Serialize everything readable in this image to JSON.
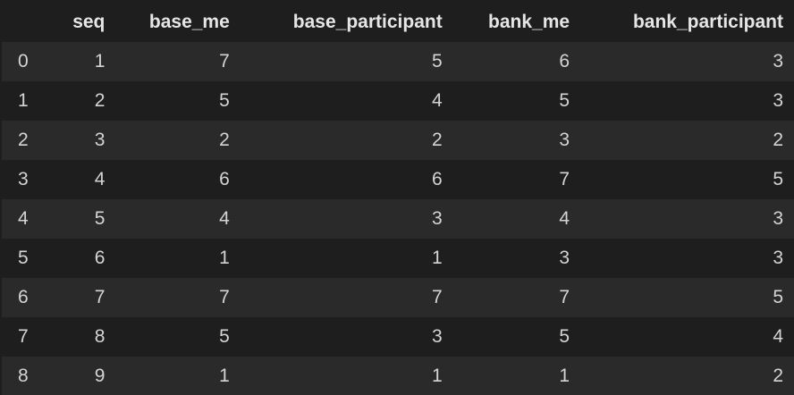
{
  "table": {
    "index_header": "",
    "columns": [
      "seq",
      "base_me",
      "base_participant",
      "bank_me",
      "bank_participant"
    ],
    "rows": [
      {
        "index": "0",
        "cells": [
          "1",
          "7",
          "5",
          "6",
          "3"
        ]
      },
      {
        "index": "1",
        "cells": [
          "2",
          "5",
          "4",
          "5",
          "3"
        ]
      },
      {
        "index": "2",
        "cells": [
          "3",
          "2",
          "2",
          "3",
          "2"
        ]
      },
      {
        "index": "3",
        "cells": [
          "4",
          "6",
          "6",
          "7",
          "5"
        ]
      },
      {
        "index": "4",
        "cells": [
          "5",
          "4",
          "3",
          "4",
          "3"
        ]
      },
      {
        "index": "5",
        "cells": [
          "6",
          "1",
          "1",
          "3",
          "3"
        ]
      },
      {
        "index": "6",
        "cells": [
          "7",
          "7",
          "7",
          "7",
          "5"
        ]
      },
      {
        "index": "7",
        "cells": [
          "8",
          "5",
          "3",
          "5",
          "4"
        ]
      },
      {
        "index": "8",
        "cells": [
          "9",
          "1",
          "1",
          "1",
          "2"
        ]
      }
    ]
  },
  "colors": {
    "background": "#1e1e1e",
    "row_stripe": "#2a2a2a",
    "text": "#d4d4d4"
  }
}
